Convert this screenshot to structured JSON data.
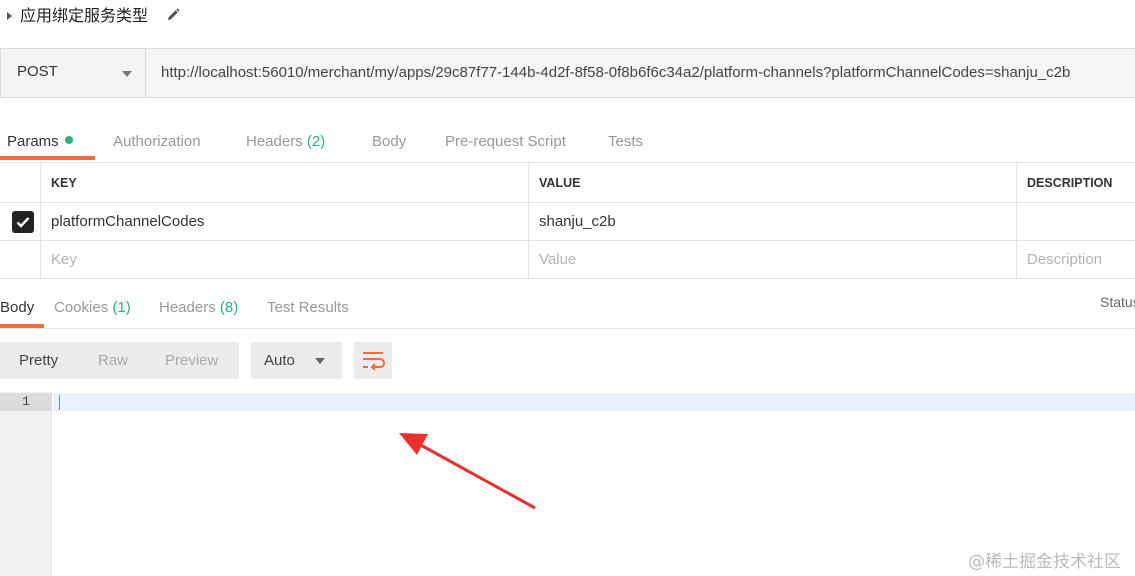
{
  "request": {
    "name": "应用绑定服务类型",
    "method": "POST",
    "url": "http://localhost:56010/merchant/my/apps/29c87f77-144b-4d2f-8f58-0f8b6f6c34a2/platform-channels?platformChannelCodes=shanju_c2b"
  },
  "request_tabs": [
    {
      "label": "Params",
      "count": ""
    },
    {
      "label": "Authorization",
      "count": ""
    },
    {
      "label": "Headers",
      "count": "(2)"
    },
    {
      "label": "Body",
      "count": ""
    },
    {
      "label": "Pre-request Script",
      "count": ""
    },
    {
      "label": "Tests",
      "count": ""
    }
  ],
  "params": {
    "headers": {
      "key": "KEY",
      "value": "VALUE",
      "description": "DESCRIPTION"
    },
    "rows": [
      {
        "checked": true,
        "key": "platformChannelCodes",
        "value": "shanju_c2b",
        "description": ""
      }
    ],
    "new_row": {
      "key_placeholder": "Key",
      "value_placeholder": "Value",
      "description_placeholder": "Description"
    }
  },
  "response_tabs": [
    {
      "label": "Body",
      "count": ""
    },
    {
      "label": "Cookies",
      "count": "(1)"
    },
    {
      "label": "Headers",
      "count": "(8)"
    },
    {
      "label": "Test Results",
      "count": ""
    }
  ],
  "status_label": "Status",
  "format": {
    "modes": [
      "Pretty",
      "Raw",
      "Preview"
    ],
    "selected_mode": "Pretty",
    "language": "Auto"
  },
  "editor": {
    "line_number": "1"
  },
  "colors": {
    "accent": "#f26b3a",
    "success": "#26b47f"
  },
  "watermark": "@稀土掘金技术社区"
}
